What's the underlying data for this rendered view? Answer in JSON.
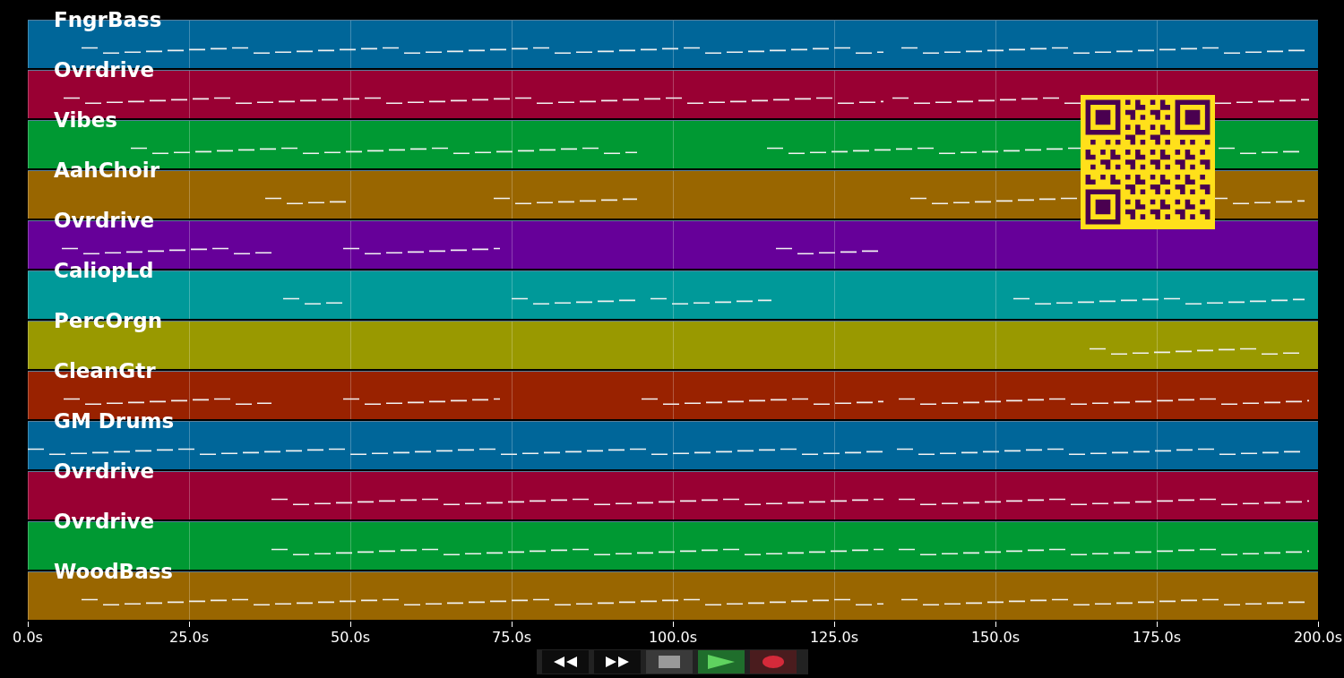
{
  "tracks": [
    {
      "name": "FngrBass",
      "color": "#006699"
    },
    {
      "name": "Ovrdrive",
      "color": "#990033"
    },
    {
      "name": "Vibes",
      "color": "#009933"
    },
    {
      "name": "AahChoir",
      "color": "#996600"
    },
    {
      "name": "Ovrdrive",
      "color": "#660099"
    },
    {
      "name": "CaliopLd",
      "color": "#009999"
    },
    {
      "name": "PercOrgn",
      "color": "#999900"
    },
    {
      "name": "CleanGtr",
      "color": "#992200"
    },
    {
      "name": "GM Drums",
      "color": "#006699"
    },
    {
      "name": "Ovrdrive",
      "color": "#990033"
    },
    {
      "name": "Ovrdrive",
      "color": "#009933"
    },
    {
      "name": "WoodBass",
      "color": "#996600"
    }
  ],
  "time_axis": [
    "0.0s",
    "25.0s",
    "50.0s",
    "75.0s",
    "100.0s",
    "125.0s",
    "150.0s",
    "175.0s",
    "200.0s"
  ],
  "transport": [
    {
      "kind": "rewind"
    },
    {
      "kind": "fast_forward"
    },
    {
      "kind": "stop"
    },
    {
      "kind": "play"
    },
    {
      "kind": "record"
    }
  ]
}
